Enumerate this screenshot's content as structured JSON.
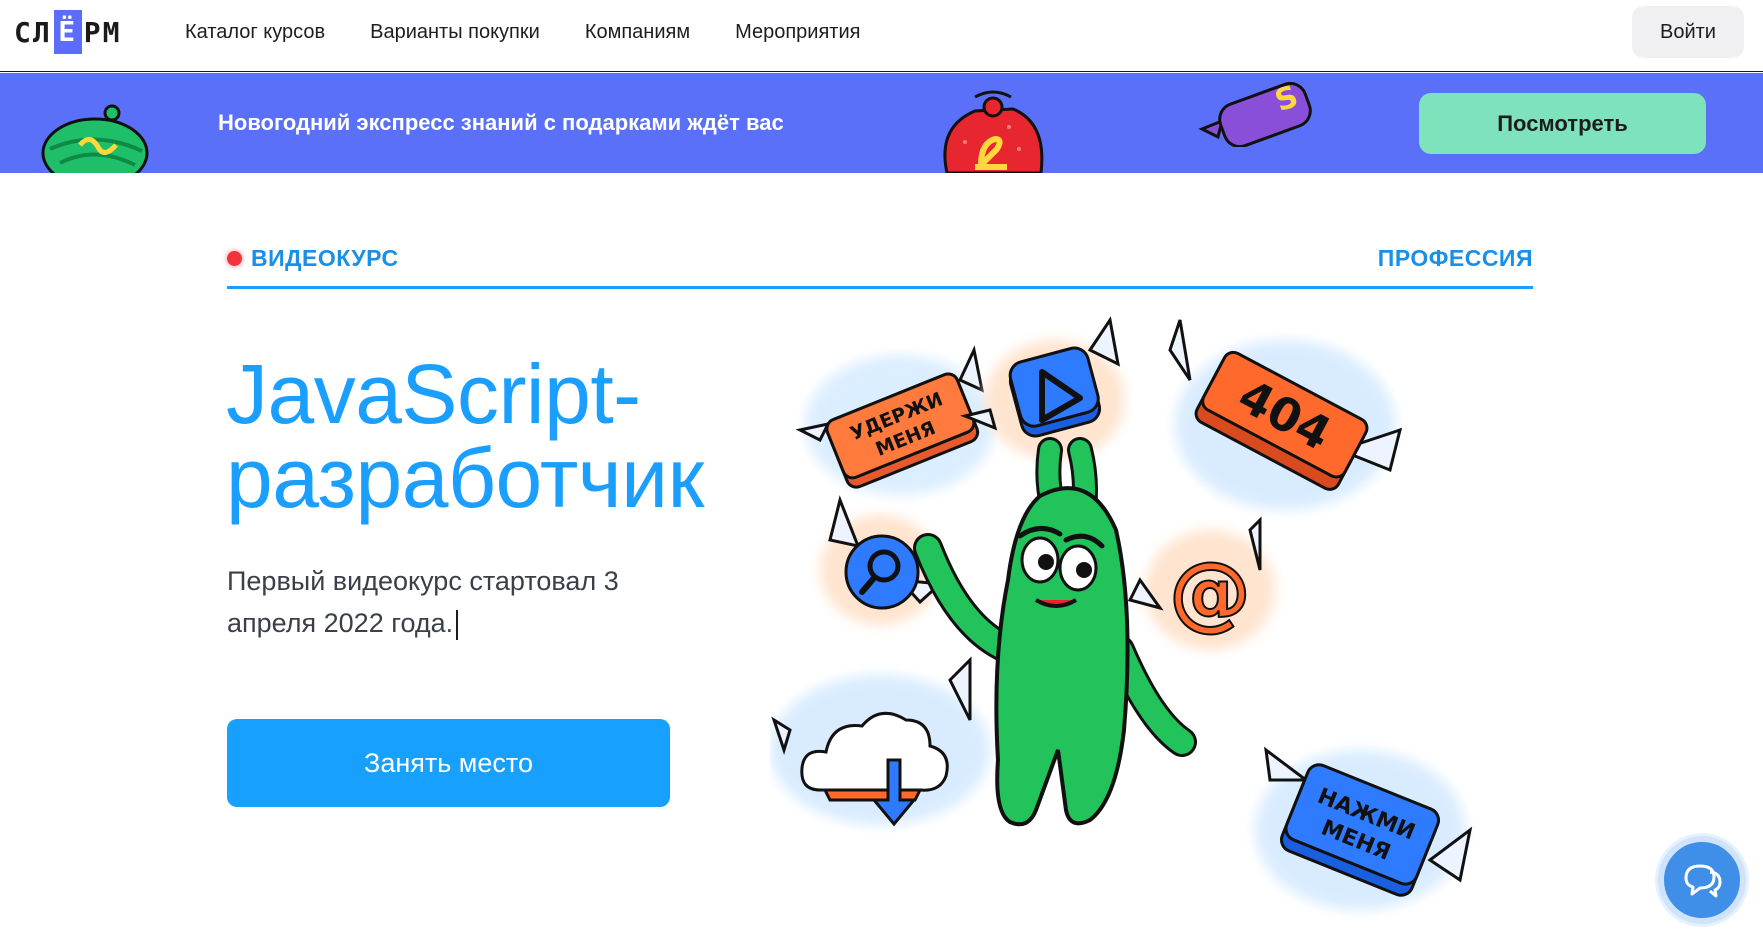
{
  "header": {
    "logo_prefix": "СЛ",
    "logo_yo": "Ё",
    "logo_suffix": "РМ",
    "nav": [
      "Каталог курсов",
      "Варианты покупки",
      "Компаниям",
      "Мероприятия"
    ],
    "login_label": "Войти"
  },
  "banner": {
    "text": "Новогодний экспресс знаний с подарками ждёт вас",
    "button_label": "Посмотреть",
    "background_color": "#5b70f8",
    "button_color": "#7ee3bc"
  },
  "tabs": {
    "left_label": "ВИДЕОКУРС",
    "right_label": "ПРОФЕССИЯ",
    "active": "ВИДЕОКУРС"
  },
  "hero": {
    "title_line1": "JavaScript-",
    "title_line2": "разработчик",
    "subtitle": "Первый видеокурс стартовал 3 апреля 2022 года.",
    "cta_label": "Занять место",
    "accent_color": "#1a9fff"
  },
  "illustration": {
    "sticker_hold": [
      "УДЕРЖИ",
      "МЕНЯ"
    ],
    "sticker_404": "404",
    "sticker_press": [
      "НАЖМИ",
      "МЕНЯ"
    ],
    "icons": [
      "play-icon",
      "search-icon",
      "at-icon",
      "cloud-download-icon",
      "green-mascot"
    ]
  },
  "chat": {
    "icon": "chat-icon"
  }
}
